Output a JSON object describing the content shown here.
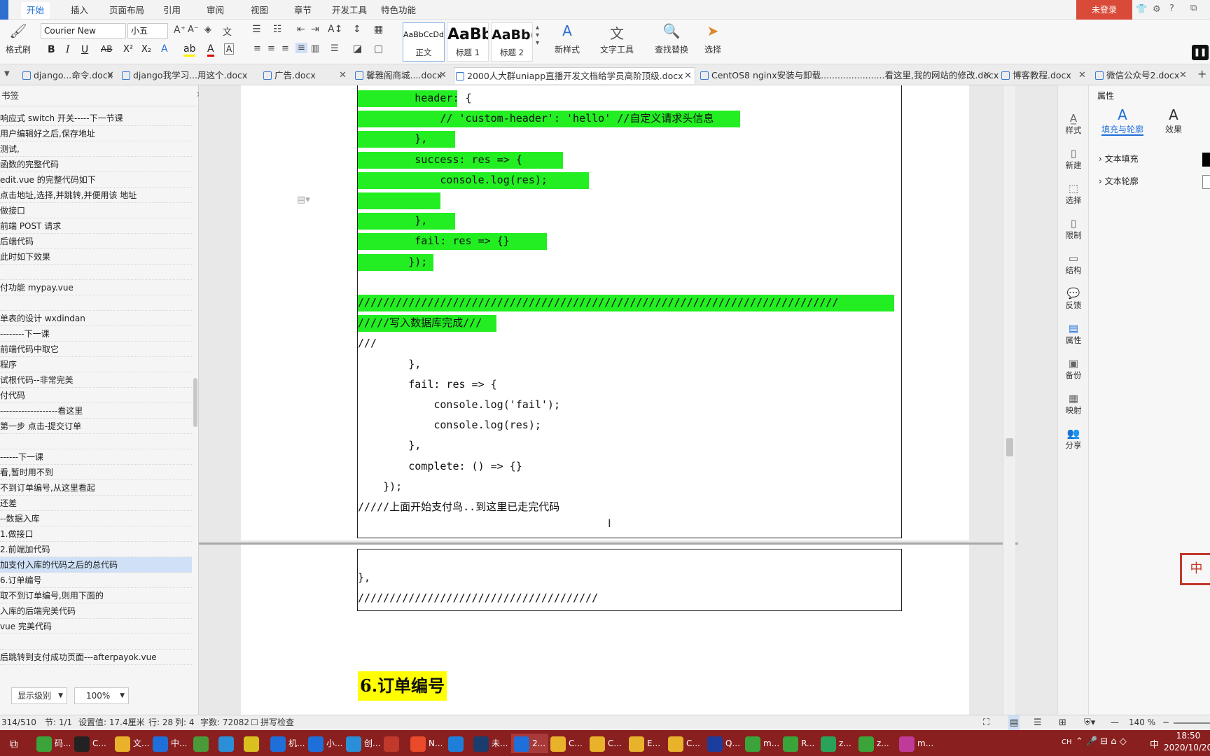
{
  "menubar": {
    "tabs": [
      "开始",
      "插入",
      "页面布局",
      "引用",
      "审阅",
      "视图",
      "章节",
      "开发工具",
      "特色功能"
    ],
    "login": "未登录"
  },
  "ribbon": {
    "format_painter": "格式刷",
    "font_name": "Courier New",
    "font_size": "小五",
    "styles": [
      {
        "preview": "AaBbCcDd",
        "name": "正文"
      },
      {
        "preview": "AaBb",
        "name": "标题 1"
      },
      {
        "preview": "AaBb(",
        "name": "标题 2"
      }
    ],
    "new_style": "新样式",
    "text_tools": "文字工具",
    "find_replace": "查找替换",
    "select": "选择"
  },
  "doc_tabs": [
    {
      "label": "django...命令.docx"
    },
    {
      "label": "django我学习...用这个.docx"
    },
    {
      "label": "广告.docx"
    },
    {
      "label": "馨雅阁商城....docx"
    },
    {
      "label": "2000人大群uniapp直播开发文档给学员高阶顶级.docx"
    },
    {
      "label": "CentOS8 nginx安装与卸载.......................看这里,我的网站的修改.docx"
    },
    {
      "label": "博客教程.docx"
    },
    {
      "label": "微信公众号2.docx"
    }
  ],
  "sidebar": {
    "title": "书签",
    "items": [
      "响应式 switch 开关-----下一节课",
      "    用户编辑好之后,保存地址",
      "    测试,",
      "    函数的完整代码",
      "    edit.vue 的完整代码如下",
      "    点击地址,选择,并跳转,并便用该  地址",
      "    做接口",
      "    前端 POST 请求",
      "    后端代码",
      "    此时如下效果",
      "",
      "付功能  mypay.vue",
      "",
      "单表的设计  wxdindan",
      "--------下一课",
      "前端代码中取它",
      "程序",
      "试根代码--非常完美",
      "付代码",
      "-------------------看这里",
      "第一步  点击-提交订单",
      "",
      "------下一课",
      "看,暂时用不到",
      "不到订单编号,从这里看起",
      "还差",
      "--数据入库",
      "1.做接口",
      "2.前端加代码",
      "加支付入库的代码之后的总代码",
      "6.订单编号",
      "取不到订单编号,则用下面的",
      "入库的后端完美代码",
      "vue 完美代码",
      "",
      "后跳转到支付成功页面---afterpayok.vue"
    ],
    "level_select": "显示级别",
    "zoom_select": "100%"
  },
  "document": {
    "code_lines": [
      {
        "text": "         header: {",
        "hl": true
      },
      {
        "text": "             // 'custom-header': 'hello' //自定义请求头信息",
        "hl": true
      },
      {
        "text": "         },",
        "hl": true
      },
      {
        "text": "         success: res => {",
        "hl": true
      },
      {
        "text": "             console.log(res);",
        "hl": true
      },
      {
        "text": "            ",
        "hl": true
      },
      {
        "text": "         },",
        "hl": true
      },
      {
        "text": "         fail: res => {}",
        "hl": true
      },
      {
        "text": "        });",
        "hl": true
      },
      {
        "text": "",
        "hl": false
      },
      {
        "text": "////////////////////////////////////////////////////////////////////////////",
        "hl": true
      },
      {
        "text": "/////写入数据库完成///",
        "hl": true
      },
      {
        "text": "///",
        "hl": false
      },
      {
        "text": "        },",
        "hl": false
      },
      {
        "text": "        fail: res => {",
        "hl": false
      },
      {
        "text": "            console.log('fail');",
        "hl": false
      },
      {
        "text": "            console.log(res);",
        "hl": false
      },
      {
        "text": "        },",
        "hl": false
      },
      {
        "text": "        complete: () => {}",
        "hl": false
      },
      {
        "text": "    });",
        "hl": false
      },
      {
        "text": "/////上面开始支付鸟..到这里已走完代码",
        "hl": false
      }
    ],
    "page2_lines": [
      {
        "text": "},"
      },
      {
        "text": "//////////////////////////////////////"
      }
    ],
    "heading": "6.订单编号"
  },
  "right_strip": [
    "样式",
    "新建",
    "选择",
    "限制",
    "结构",
    "反馈",
    "属性",
    "备份",
    "映射",
    "分享"
  ],
  "props_panel": {
    "title": "属性",
    "tabs": [
      "填充与轮廓",
      "效果"
    ],
    "sections": [
      "文本填充",
      "文本轮廓"
    ]
  },
  "statusbar": {
    "items": [
      "314/510",
      "节: 1/1",
      "设置值: 17.4厘米",
      "行: 28",
      "列: 4",
      "字数: 72082",
      "拼写检查"
    ],
    "zoom": "140 %"
  },
  "taskbar": {
    "apps": [
      "码...",
      "C...",
      "文...",
      "中...",
      "",
      "",
      "",
      "机...",
      "小...",
      "创...",
      "",
      "N...",
      "",
      "未...",
      "2...",
      "C...",
      "C...",
      "E...",
      "C...",
      "Q...",
      "m...",
      "R...",
      "z...",
      "z...",
      "m..."
    ],
    "time": "18:50",
    "date": "2020/10/20",
    "ime": "中",
    "lang": "CH"
  }
}
